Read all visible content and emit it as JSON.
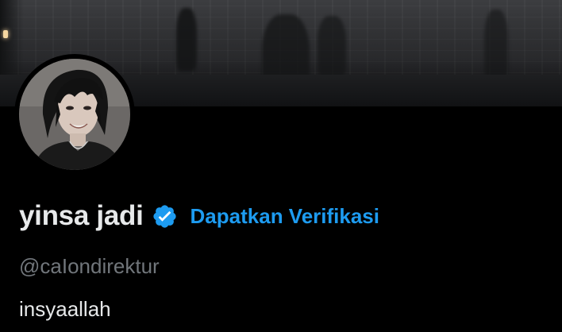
{
  "profile": {
    "display_name": "yinsa jadi",
    "verified_icon": "verified-badge-icon",
    "get_verified_label": "Dapatkan Verifikasi",
    "handle": "@caIondirektur",
    "bio": "insyaallah"
  },
  "colors": {
    "background": "#000000",
    "primary_text": "#e7e9ea",
    "secondary_text": "#71767b",
    "accent": "#1d9bf0"
  }
}
